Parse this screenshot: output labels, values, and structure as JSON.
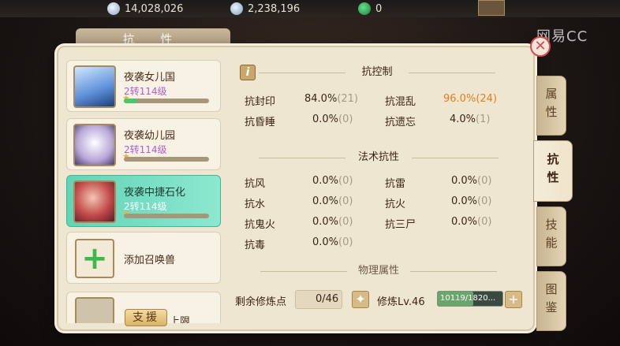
{
  "currencies": [
    {
      "icon": "silver-coin-icon",
      "value": "14,028,026"
    },
    {
      "icon": "cloud-coin-icon",
      "value": "2,238,196"
    },
    {
      "icon": "jade-icon",
      "value": "0"
    }
  ],
  "watermark": "网易CC",
  "panel_title": "抗 性",
  "close_label": "✕",
  "side_tabs": [
    {
      "label": "属性",
      "active": false
    },
    {
      "label": "抗性",
      "active": true
    },
    {
      "label": "技能",
      "active": false
    },
    {
      "label": "图鉴",
      "active": false
    }
  ],
  "pets": [
    {
      "name": "夜袭女儿国",
      "level": "2转114级",
      "exp_fraction": 0.15,
      "avatar": "av1",
      "active": false
    },
    {
      "name": "夜袭幼儿园",
      "level": "2转114级",
      "exp_fraction": 0.0,
      "avatar": "av2",
      "active": false
    },
    {
      "name": "夜袭中捷石化",
      "level": "2转114级",
      "exp_fraction": 0.0,
      "avatar": "av3",
      "active": true
    }
  ],
  "add_pet_label": "添加召唤兽",
  "lock_text": "上限",
  "support_label": "支援",
  "info_glyph": "i",
  "sections": {
    "control": {
      "title": "抗控制",
      "items": [
        {
          "label": "抗封印",
          "value": "84.0%",
          "bonus": "(21)",
          "highlight": false
        },
        {
          "label": "抗混乱",
          "value": "96.0%",
          "bonus": "(24)",
          "highlight": true
        },
        {
          "label": "抗昏睡",
          "value": "0.0%",
          "bonus": "(0)",
          "highlight": false
        },
        {
          "label": "抗遗忘",
          "value": "4.0%",
          "bonus": "(1)",
          "highlight": false
        }
      ]
    },
    "magic": {
      "title": "法术抗性",
      "items": [
        {
          "label": "抗风",
          "value": "0.0%",
          "bonus": "(0)"
        },
        {
          "label": "抗雷",
          "value": "0.0%",
          "bonus": "(0)"
        },
        {
          "label": "抗水",
          "value": "0.0%",
          "bonus": "(0)"
        },
        {
          "label": "抗火",
          "value": "0.0%",
          "bonus": "(0)"
        },
        {
          "label": "抗鬼火",
          "value": "0.0%",
          "bonus": "(0)"
        },
        {
          "label": "抗三尸",
          "value": "0.0%",
          "bonus": "(0)"
        },
        {
          "label": "抗毒",
          "value": "0.0%",
          "bonus": "(0)"
        }
      ]
    },
    "physical": {
      "title": "物理属性"
    }
  },
  "bottom": {
    "remaining_label": "剩余修炼点",
    "remaining_value": "0/46",
    "cultivation_label": "修炼Lv.46",
    "exp_text": "10119/1820...",
    "exp_fraction": 0.55,
    "plus_label": "+"
  },
  "colors": {
    "active_card": "#62d4b6",
    "highlight_value": "#e0801e",
    "level_text": "#b05fd2"
  }
}
